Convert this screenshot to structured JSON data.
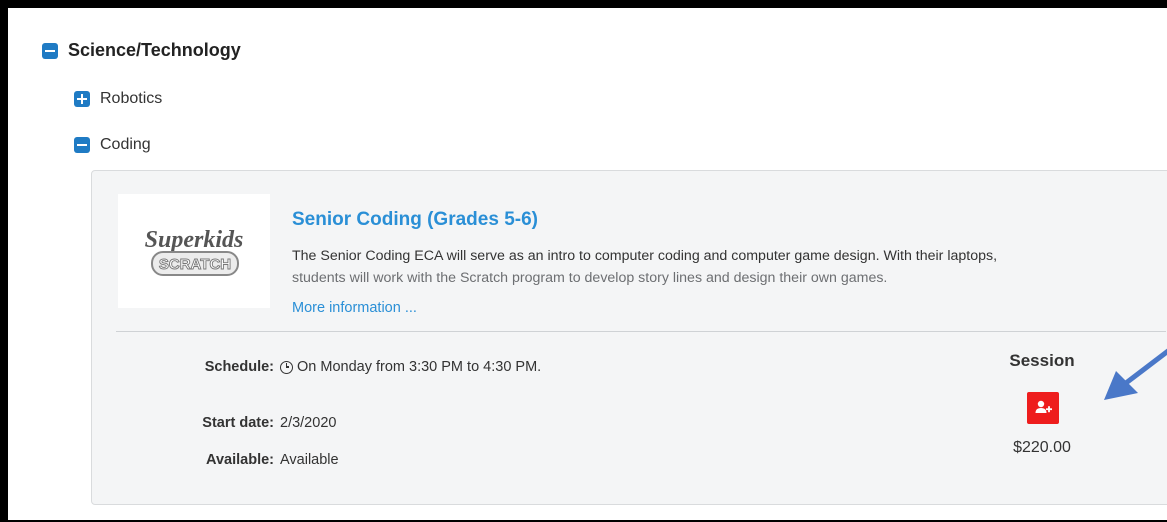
{
  "tree": {
    "category": {
      "label": "Science/Technology",
      "toggle": "minus"
    },
    "subcategories": [
      {
        "label": "Robotics",
        "toggle": "plus"
      },
      {
        "label": "Coding",
        "toggle": "minus"
      }
    ]
  },
  "course": {
    "logo_text": "Superkids",
    "logo_subtext": "SCRATCH",
    "title": "Senior Coding (Grades 5-6)",
    "description_line1": "The Senior Coding ECA will serve as an intro to computer coding and computer game design. With their laptops,",
    "description_line2": "students will work with the Scratch program to develop story lines and design their own games.",
    "more_link": "More information ...",
    "schedule_label": "Schedule:",
    "schedule_value": "On Monday from 3:30 PM to 4:30 PM.",
    "start_label": "Start date:",
    "start_value": "2/3/2020",
    "available_label": "Available:",
    "available_value": "Available"
  },
  "session": {
    "title": "Session",
    "price": "$220.00",
    "button_icon": "add-user-icon"
  },
  "colors": {
    "accent_blue": "#2a8fd6",
    "toggle_blue": "#1f7bc4",
    "enroll_red": "#ee1d1d",
    "arrow_blue": "#4a78c8"
  }
}
